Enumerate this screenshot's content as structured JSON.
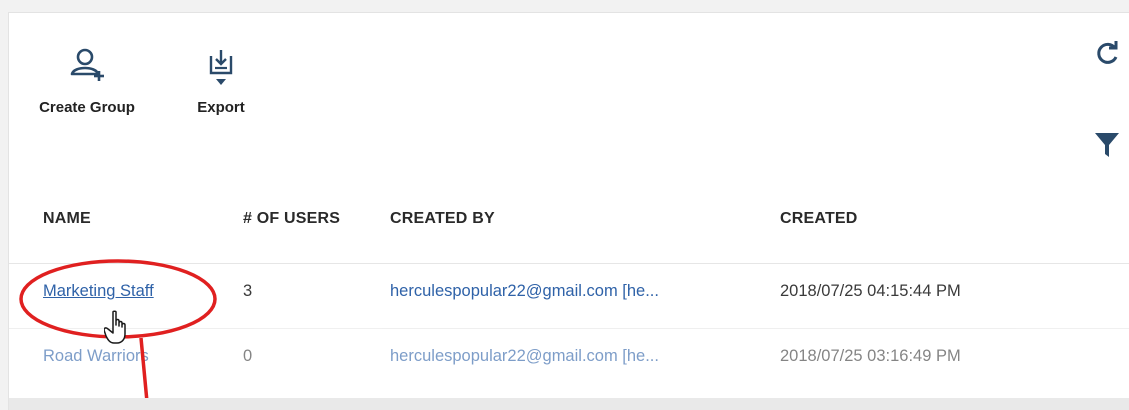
{
  "toolbar": {
    "create_group_label": "Create Group",
    "export_label": "Export",
    "refresh_icon": "refresh-icon",
    "filter_icon": "filter-icon"
  },
  "table": {
    "headers": {
      "name": "NAME",
      "users": "# OF USERS",
      "created_by": "CREATED BY",
      "created": "CREATED"
    },
    "rows": [
      {
        "name": "Marketing Staff",
        "users": "3",
        "created_by": "herculespopular22@gmail.com [he...",
        "created": "2018/07/25 04:15:44 PM"
      },
      {
        "name": "Road Warriors",
        "users": "0",
        "created_by": "herculespopular22@gmail.com [he...",
        "created": "2018/07/25 03:16:49 PM"
      }
    ]
  },
  "colors": {
    "link": "#2f62a8",
    "icon": "#2a4a6a",
    "highlight": "#e02020"
  }
}
